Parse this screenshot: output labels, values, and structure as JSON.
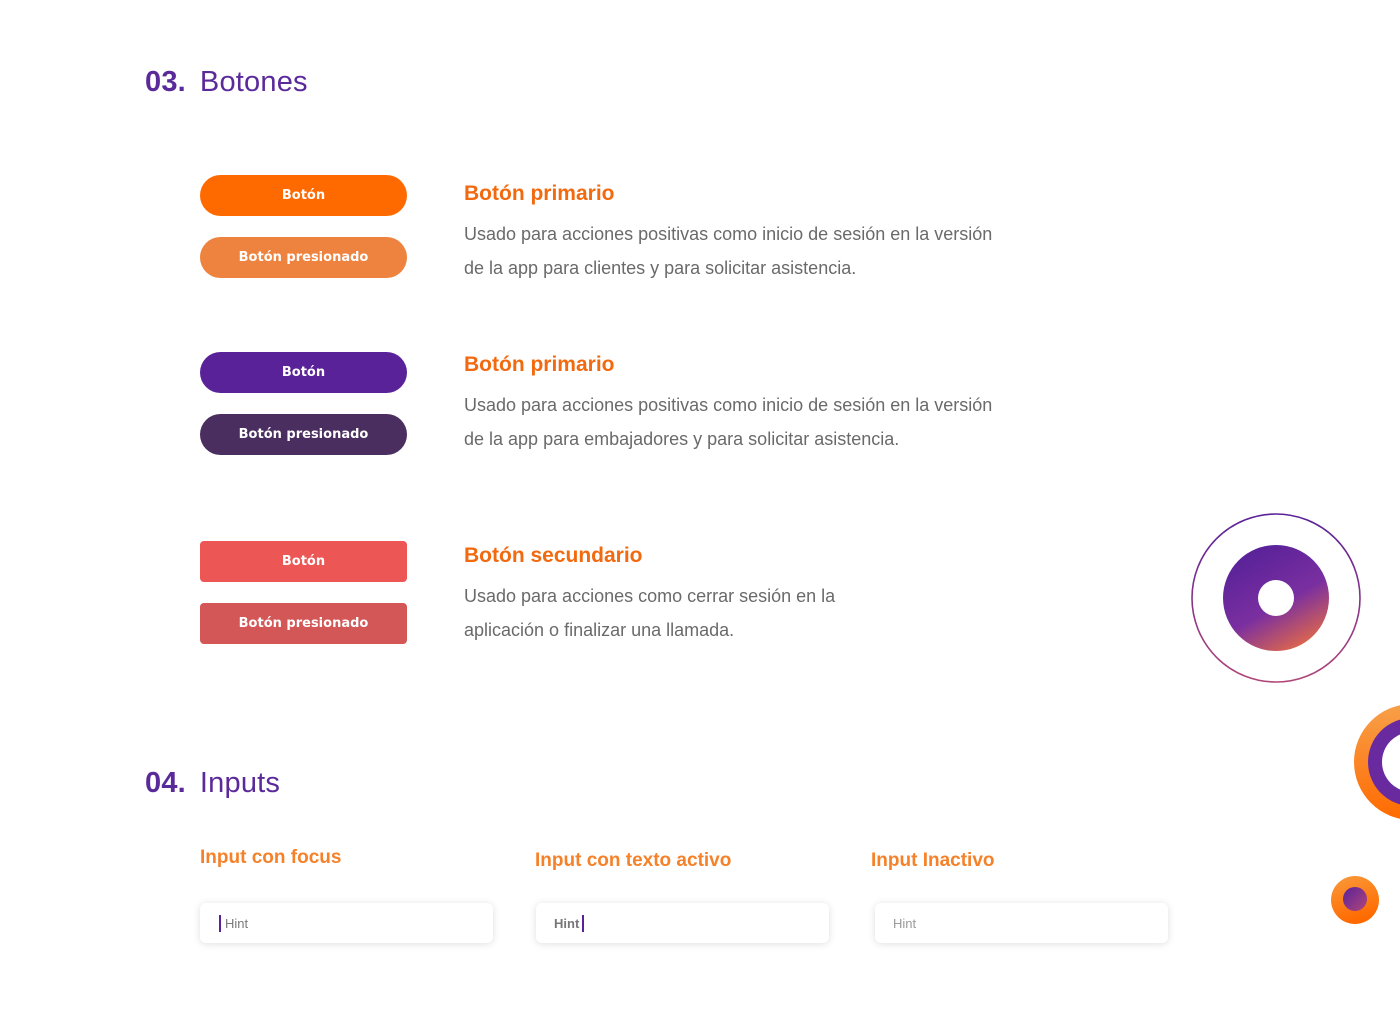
{
  "sections": {
    "buttons": {
      "number": "03.",
      "title": "Botones"
    },
    "inputs": {
      "number": "04.",
      "title": "Inputs"
    }
  },
  "button_groups": [
    {
      "normal_label": "Botón",
      "pressed_label": "Botón presionado",
      "title": "Botón primario",
      "desc_line1": "Usado para acciones positivas como inicio de sesión en la versión",
      "desc_line2": "de la app para clientes y para solicitar asistencia.",
      "colors": {
        "normal": "#ff6a00",
        "pressed": "#ee8340"
      }
    },
    {
      "normal_label": "Botón",
      "pressed_label": "Botón presionado",
      "title": "Botón primario",
      "desc_line1": "Usado para acciones positivas como inicio de sesión en la versión",
      "desc_line2": "de la app para embajadores y para solicitar asistencia.",
      "colors": {
        "normal": "#5a2299",
        "pressed": "#4a2e5f"
      }
    },
    {
      "normal_label": "Botón",
      "pressed_label": "Botón presionado",
      "title": "Botón secundario",
      "desc_line1": "Usado para acciones como cerrar sesión en la",
      "desc_line2": "aplicación o finalizar una llamada.",
      "colors": {
        "normal": "#ec5655",
        "pressed": "#d35756"
      }
    }
  ],
  "inputs": [
    {
      "title": "Input con focus",
      "hint": "Hint",
      "state": "focus"
    },
    {
      "title": "Input con texto activo",
      "hint": "Hint",
      "state": "active"
    },
    {
      "title": "Input Inactivo",
      "hint": "Hint",
      "state": "inactive"
    }
  ],
  "colors": {
    "accent_orange": "#f26a10",
    "accent_purple": "#5b2a9a",
    "body_text": "#6a6a6a"
  },
  "icons": {
    "decor_large": "ring-logo-icon",
    "decor_edge": "partial-ring-icon",
    "decor_small": "small-ring-logo-icon"
  }
}
